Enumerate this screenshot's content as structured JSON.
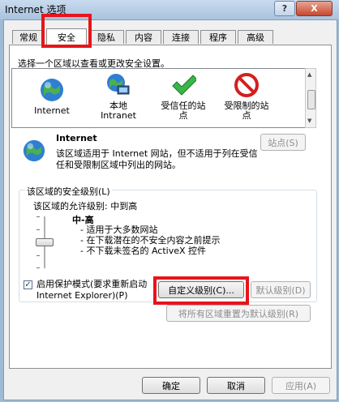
{
  "window": {
    "title": "Internet 选项",
    "help_label": "?",
    "close_label": "X"
  },
  "tabs": [
    {
      "label": "常规"
    },
    {
      "label": "安全"
    },
    {
      "label": "隐私"
    },
    {
      "label": "内容"
    },
    {
      "label": "连接"
    },
    {
      "label": "程序"
    },
    {
      "label": "高级"
    }
  ],
  "security": {
    "prompt": "选择一个区域以查看或更改安全设置。",
    "zones": [
      {
        "name": "Internet",
        "icon": "globe-icon"
      },
      {
        "name": "本地\nIntranet",
        "icon": "intranet-icon"
      },
      {
        "name": "受信任的站\n点",
        "icon": "check-icon"
      },
      {
        "name": "受限制的站\n点",
        "icon": "no-entry-icon"
      }
    ],
    "selected_zone_title": "Internet",
    "sites_button": "站点(S)",
    "zone_description": "该区域适用于 Internet 网站，但不适用于列在受信任和受限制区域中列出的网站。",
    "level_group_label": "该区域的安全级别(L)",
    "allowed_levels": "该区域的允许级别: 中到高",
    "level_name": "中-高",
    "level_bullets": [
      "- 适用于大多数网站",
      "- 在下载潜在的不安全内容之前提示",
      "- 不下载未签名的 ActiveX 控件"
    ],
    "slider_level": 0.5,
    "protected_mode_label": "启用保护模式(要求重新启动 Internet Explorer)(P)",
    "protected_mode_checked": true,
    "custom_level_button": "自定义级别(C)...",
    "default_level_button": "默认级别(D)",
    "reset_all_button": "将所有区域重置为默认级别(R)"
  },
  "footer": {
    "ok_button": "确定",
    "cancel_button": "取消",
    "apply_button": "应用(A)"
  },
  "colors": {
    "highlight_red": "#e8141b",
    "title_gradient_top": "#c9dbee",
    "button_border": "#707070"
  }
}
